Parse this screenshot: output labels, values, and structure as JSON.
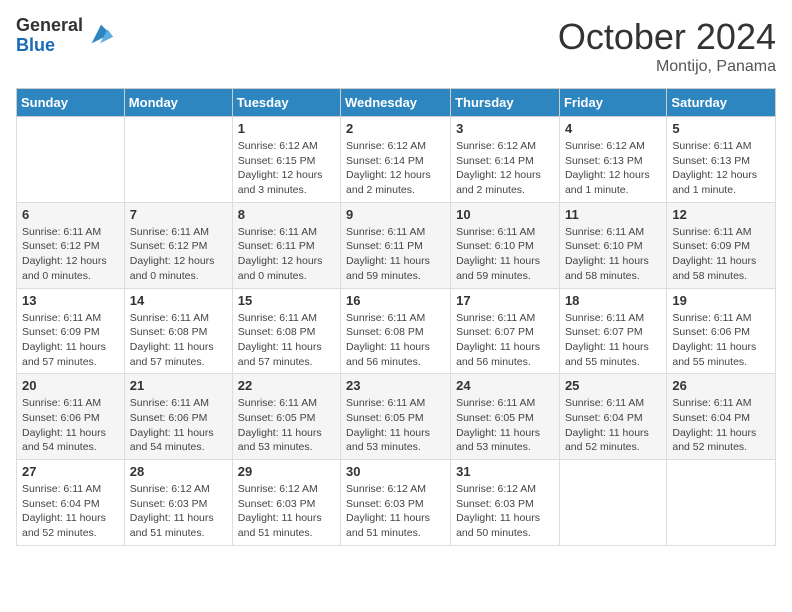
{
  "logo": {
    "general": "General",
    "blue": "Blue"
  },
  "title": "October 2024",
  "subtitle": "Montijo, Panama",
  "days_header": [
    "Sunday",
    "Monday",
    "Tuesday",
    "Wednesday",
    "Thursday",
    "Friday",
    "Saturday"
  ],
  "weeks": [
    [
      {
        "day": "",
        "info": ""
      },
      {
        "day": "",
        "info": ""
      },
      {
        "day": "1",
        "info": "Sunrise: 6:12 AM\nSunset: 6:15 PM\nDaylight: 12 hours and 3 minutes."
      },
      {
        "day": "2",
        "info": "Sunrise: 6:12 AM\nSunset: 6:14 PM\nDaylight: 12 hours and 2 minutes."
      },
      {
        "day": "3",
        "info": "Sunrise: 6:12 AM\nSunset: 6:14 PM\nDaylight: 12 hours and 2 minutes."
      },
      {
        "day": "4",
        "info": "Sunrise: 6:12 AM\nSunset: 6:13 PM\nDaylight: 12 hours and 1 minute."
      },
      {
        "day": "5",
        "info": "Sunrise: 6:11 AM\nSunset: 6:13 PM\nDaylight: 12 hours and 1 minute."
      }
    ],
    [
      {
        "day": "6",
        "info": "Sunrise: 6:11 AM\nSunset: 6:12 PM\nDaylight: 12 hours and 0 minutes."
      },
      {
        "day": "7",
        "info": "Sunrise: 6:11 AM\nSunset: 6:12 PM\nDaylight: 12 hours and 0 minutes."
      },
      {
        "day": "8",
        "info": "Sunrise: 6:11 AM\nSunset: 6:11 PM\nDaylight: 12 hours and 0 minutes."
      },
      {
        "day": "9",
        "info": "Sunrise: 6:11 AM\nSunset: 6:11 PM\nDaylight: 11 hours and 59 minutes."
      },
      {
        "day": "10",
        "info": "Sunrise: 6:11 AM\nSunset: 6:10 PM\nDaylight: 11 hours and 59 minutes."
      },
      {
        "day": "11",
        "info": "Sunrise: 6:11 AM\nSunset: 6:10 PM\nDaylight: 11 hours and 58 minutes."
      },
      {
        "day": "12",
        "info": "Sunrise: 6:11 AM\nSunset: 6:09 PM\nDaylight: 11 hours and 58 minutes."
      }
    ],
    [
      {
        "day": "13",
        "info": "Sunrise: 6:11 AM\nSunset: 6:09 PM\nDaylight: 11 hours and 57 minutes."
      },
      {
        "day": "14",
        "info": "Sunrise: 6:11 AM\nSunset: 6:08 PM\nDaylight: 11 hours and 57 minutes."
      },
      {
        "day": "15",
        "info": "Sunrise: 6:11 AM\nSunset: 6:08 PM\nDaylight: 11 hours and 57 minutes."
      },
      {
        "day": "16",
        "info": "Sunrise: 6:11 AM\nSunset: 6:08 PM\nDaylight: 11 hours and 56 minutes."
      },
      {
        "day": "17",
        "info": "Sunrise: 6:11 AM\nSunset: 6:07 PM\nDaylight: 11 hours and 56 minutes."
      },
      {
        "day": "18",
        "info": "Sunrise: 6:11 AM\nSunset: 6:07 PM\nDaylight: 11 hours and 55 minutes."
      },
      {
        "day": "19",
        "info": "Sunrise: 6:11 AM\nSunset: 6:06 PM\nDaylight: 11 hours and 55 minutes."
      }
    ],
    [
      {
        "day": "20",
        "info": "Sunrise: 6:11 AM\nSunset: 6:06 PM\nDaylight: 11 hours and 54 minutes."
      },
      {
        "day": "21",
        "info": "Sunrise: 6:11 AM\nSunset: 6:06 PM\nDaylight: 11 hours and 54 minutes."
      },
      {
        "day": "22",
        "info": "Sunrise: 6:11 AM\nSunset: 6:05 PM\nDaylight: 11 hours and 53 minutes."
      },
      {
        "day": "23",
        "info": "Sunrise: 6:11 AM\nSunset: 6:05 PM\nDaylight: 11 hours and 53 minutes."
      },
      {
        "day": "24",
        "info": "Sunrise: 6:11 AM\nSunset: 6:05 PM\nDaylight: 11 hours and 53 minutes."
      },
      {
        "day": "25",
        "info": "Sunrise: 6:11 AM\nSunset: 6:04 PM\nDaylight: 11 hours and 52 minutes."
      },
      {
        "day": "26",
        "info": "Sunrise: 6:11 AM\nSunset: 6:04 PM\nDaylight: 11 hours and 52 minutes."
      }
    ],
    [
      {
        "day": "27",
        "info": "Sunrise: 6:11 AM\nSunset: 6:04 PM\nDaylight: 11 hours and 52 minutes."
      },
      {
        "day": "28",
        "info": "Sunrise: 6:12 AM\nSunset: 6:03 PM\nDaylight: 11 hours and 51 minutes."
      },
      {
        "day": "29",
        "info": "Sunrise: 6:12 AM\nSunset: 6:03 PM\nDaylight: 11 hours and 51 minutes."
      },
      {
        "day": "30",
        "info": "Sunrise: 6:12 AM\nSunset: 6:03 PM\nDaylight: 11 hours and 51 minutes."
      },
      {
        "day": "31",
        "info": "Sunrise: 6:12 AM\nSunset: 6:03 PM\nDaylight: 11 hours and 50 minutes."
      },
      {
        "day": "",
        "info": ""
      },
      {
        "day": "",
        "info": ""
      }
    ]
  ]
}
